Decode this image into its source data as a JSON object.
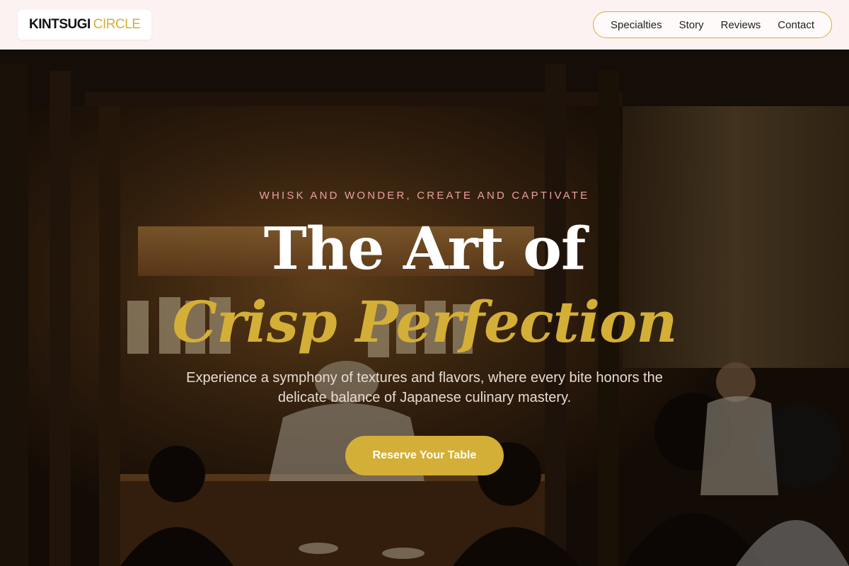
{
  "header": {
    "logo_word1": "KINTSUGI",
    "logo_word2": "CIRCLE",
    "nav": [
      "Specialties",
      "Story",
      "Reviews",
      "Contact"
    ]
  },
  "hero": {
    "tagline": "WHISK AND WONDER, CREATE AND CAPTIVATE",
    "title_line1": "The Art of",
    "title_line2": "Crisp Perfection",
    "subtitle": "Experience a symphony of textures and flavors, where every bite honors the delicate balance of Japanese culinary mastery.",
    "cta_label": "Reserve Your Table"
  },
  "colors": {
    "accent_gold": "#d4af37",
    "header_bg": "#fdf2f2",
    "tagline_pink": "#e8a0a0"
  }
}
